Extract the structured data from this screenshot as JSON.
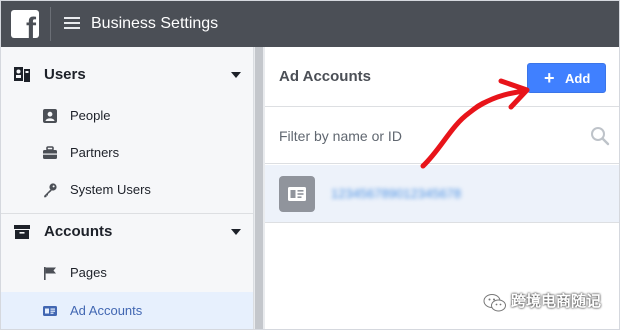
{
  "app": {
    "title": "Business Settings",
    "logo_letter": "f"
  },
  "sidebar": {
    "sections": [
      {
        "label": "Users",
        "items": [
          {
            "label": "People",
            "icon": "person-icon"
          },
          {
            "label": "Partners",
            "icon": "briefcase-icon"
          },
          {
            "label": "System Users",
            "icon": "key-icon"
          }
        ]
      },
      {
        "label": "Accounts",
        "items": [
          {
            "label": "Pages",
            "icon": "flag-icon"
          },
          {
            "label": "Ad Accounts",
            "icon": "ad-account-icon",
            "active": true
          }
        ]
      }
    ]
  },
  "main": {
    "title": "Ad Accounts",
    "add_button": {
      "label": "Add",
      "icon": "plus-icon"
    },
    "filter": {
      "placeholder": "Filter by name or ID",
      "value": ""
    },
    "accounts": [
      {
        "name": "123456789012345678"
      }
    ]
  },
  "watermark": {
    "text": "跨境电商随记"
  },
  "colors": {
    "topbar": "#4b4f56",
    "sidebar_bg": "#f6f7f9",
    "accent": "#4080ff",
    "active_bg": "#e7f0fd",
    "annotation": "#e8141a"
  }
}
